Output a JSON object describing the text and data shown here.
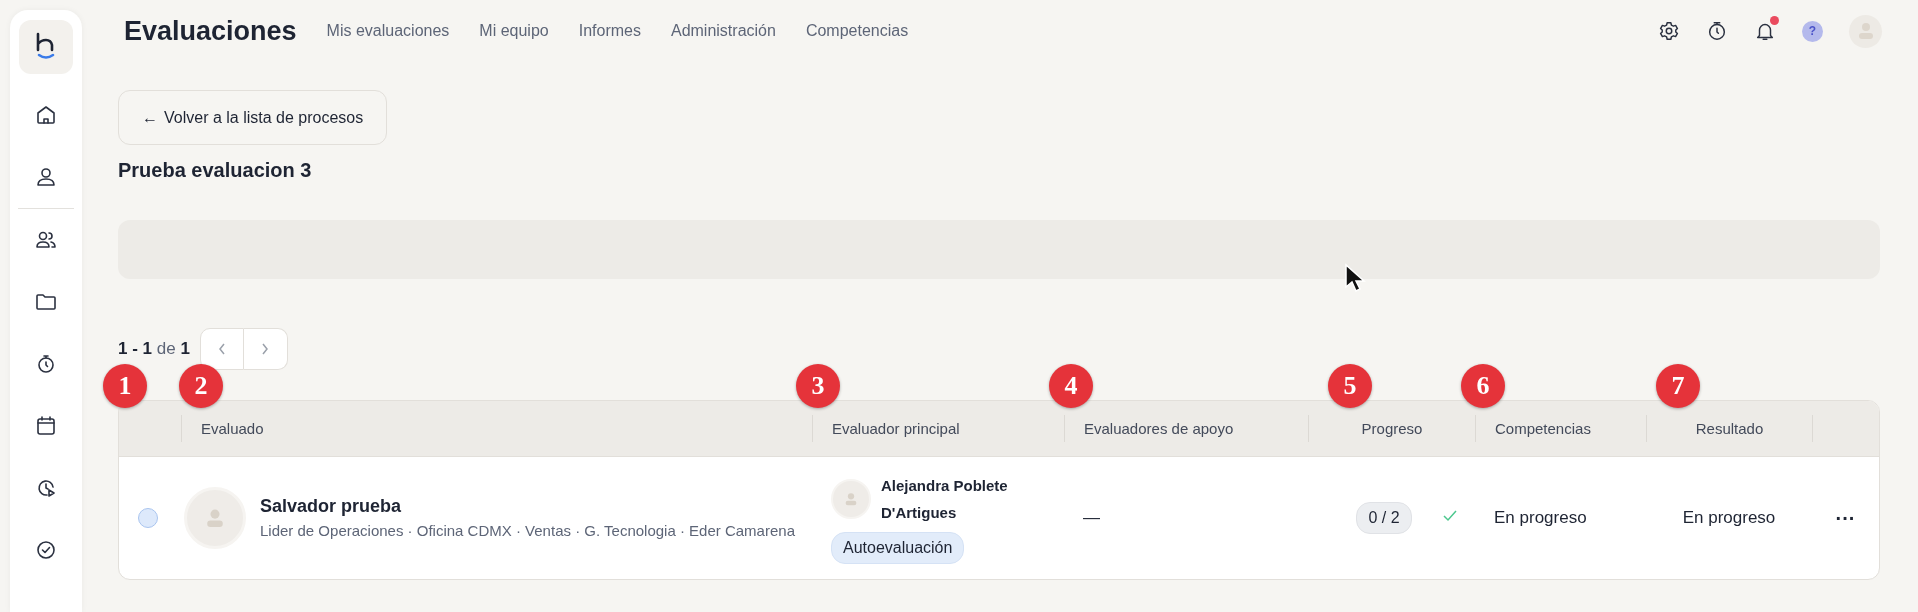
{
  "header": {
    "title": "Evaluaciones",
    "nav": [
      "Mis evaluaciones",
      "Mi equipo",
      "Informes",
      "Administración",
      "Competencias"
    ],
    "notification_unread": true,
    "help": "?"
  },
  "back_button": {
    "icon": "←",
    "label": "Volver a la lista de procesos"
  },
  "process_title": "Prueba evaluacion 3",
  "pagination": {
    "range": "1 - 1",
    "of": "de",
    "total": "1"
  },
  "table": {
    "columns": [
      "Evaluado",
      "Evaluador principal",
      "Evaluadores de apoyo",
      "Progreso",
      "Competencias",
      "Resultado"
    ],
    "rows": [
      {
        "selected": false,
        "evaluado": {
          "name": "Salvador prueba",
          "details": "Lider de Operaciones · Oficina CDMX · Ventas · G. Tecnologia · Eder Camarena"
        },
        "evaluador": {
          "name": "Alejandra Poblete D'Artigues",
          "tag": "Autoevaluación"
        },
        "apoyo": "—",
        "progreso": "0 / 2",
        "progress_confirmed": true,
        "competencias": "En progreso",
        "resultado": "En progreso",
        "menu": "···"
      }
    ]
  },
  "annotations": [
    "1",
    "2",
    "3",
    "4",
    "5",
    "6",
    "7"
  ]
}
